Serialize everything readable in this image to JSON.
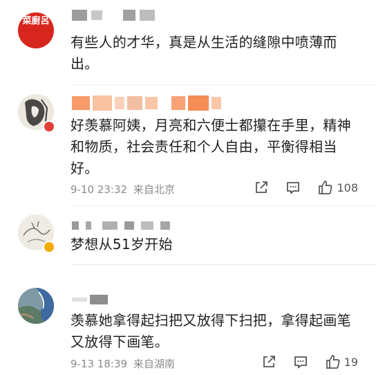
{
  "comments": [
    {
      "avatar_text": "菜廚呂",
      "text": "有些人的才华，真是从生活的缝隙中喷薄而出。"
    },
    {
      "text": "好羡慕阿姨，月亮和六便士都攥在手里，精神和物质，社会责任和个人自由，平衡得相当好。",
      "date": "9-10 23:32",
      "location": "来自北京",
      "likes": "108"
    },
    {
      "text": "梦想从51岁开始"
    },
    {
      "text": "羡慕她拿得起扫把又放得下扫把，拿得起画笔又放得下画笔。",
      "date": "9-13 18:39",
      "location": "来自湖南",
      "likes": "19"
    }
  ],
  "colors": {
    "brand_red": "#d7261e",
    "badge_red": "#e0403a",
    "badge_gold": "#f2a900",
    "meta_gray": "#8a8a8a",
    "blur_orange": "#f47a3a"
  },
  "icons": [
    "share-icon",
    "comment-icon",
    "like-icon"
  ]
}
